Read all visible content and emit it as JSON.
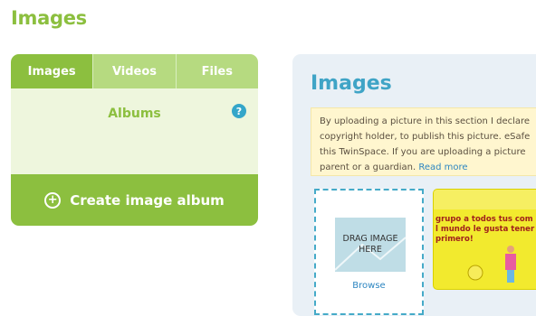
{
  "page": {
    "title": "Images"
  },
  "left_panel": {
    "tabs": [
      {
        "label": "Images",
        "active": true
      },
      {
        "label": "Videos",
        "active": false
      },
      {
        "label": "Files",
        "active": false
      }
    ],
    "albums_label": "Albums",
    "help_icon_glyph": "?",
    "create_button_label": "Create image album"
  },
  "right_panel": {
    "title": "Images",
    "notice": {
      "lines": [
        "By uploading a picture in this section I declare",
        "copyright holder, to publish this picture. eSafe",
        "this TwinSpace. If you are uploading a picture",
        "parent or a guardian. "
      ],
      "read_more": "Read more"
    },
    "dropzone": {
      "line1": "DRAG IMAGE",
      "line2": "HERE",
      "browse": "Browse"
    },
    "thumbnail": {
      "lines": [
        "grupo a todos tus com",
        "l mundo le gusta tener",
        "primero!"
      ]
    }
  },
  "colors": {
    "brand_green": "#8cbf3f",
    "light_green": "#b6da80",
    "accent_blue": "#3fa4c6",
    "notice_bg": "#fff6cf"
  }
}
